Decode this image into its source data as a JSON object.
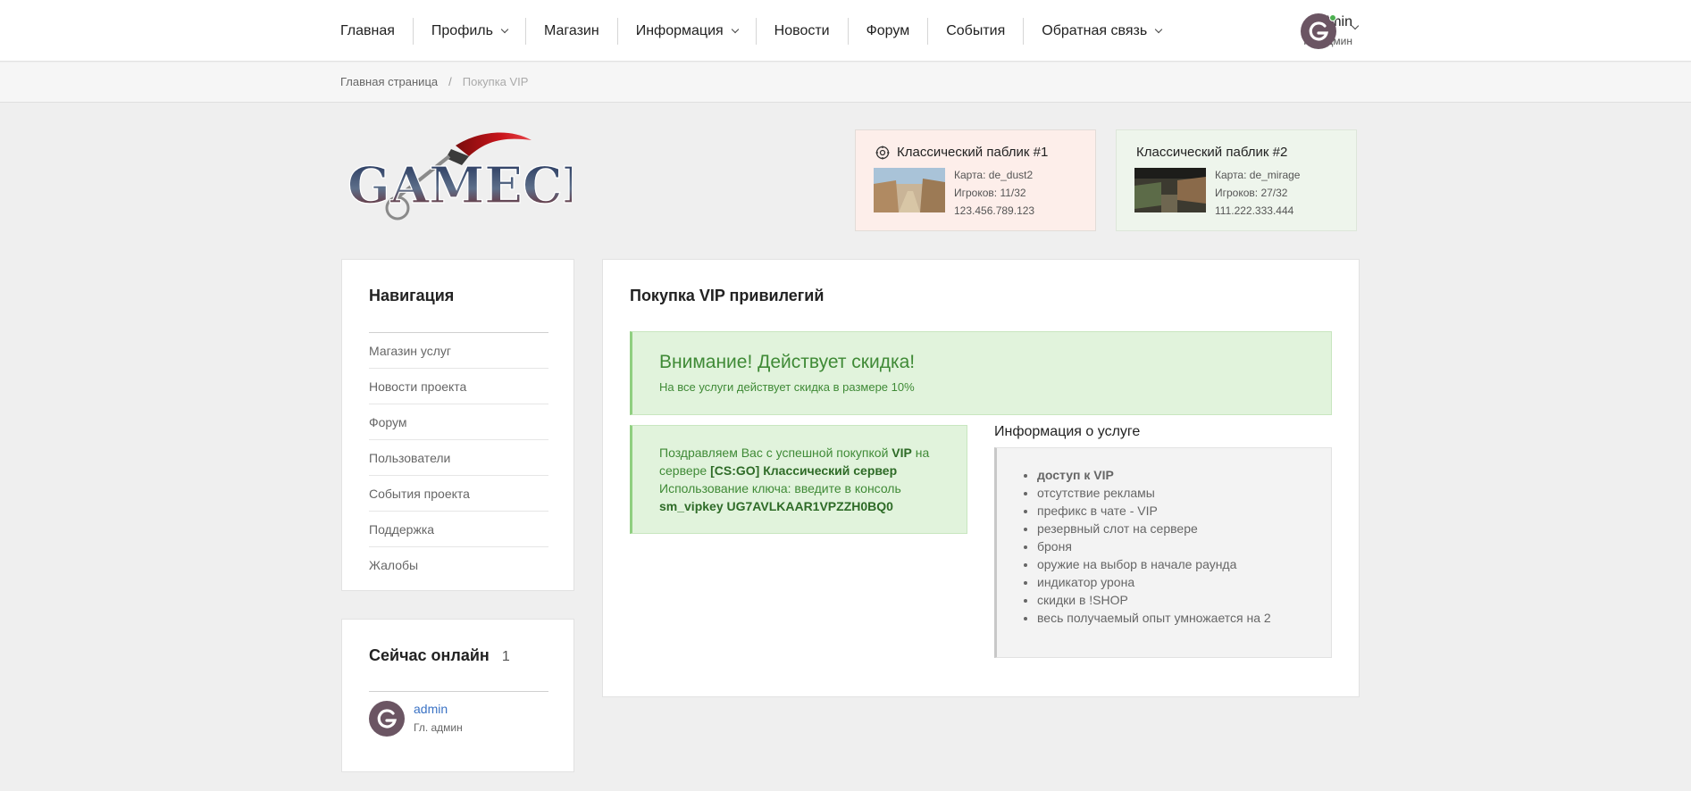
{
  "nav": {
    "items": [
      {
        "label": "Главная",
        "dropdown": false
      },
      {
        "label": "Профиль",
        "dropdown": true
      },
      {
        "label": "Магазин",
        "dropdown": false
      },
      {
        "label": "Информация",
        "dropdown": true
      },
      {
        "label": "Новости",
        "dropdown": false
      },
      {
        "label": "Форум",
        "dropdown": false
      },
      {
        "label": "События",
        "dropdown": false
      },
      {
        "label": "Обратная связь",
        "dropdown": true
      }
    ],
    "user": {
      "name": "admin",
      "role": "Гл. админ",
      "status_color": "#4caf50"
    }
  },
  "breadcrumb": {
    "home": "Главная страница",
    "separator": "/",
    "current": "Покупка VIP"
  },
  "logo": {
    "text": "GAMECMS"
  },
  "servers": [
    {
      "title": "Классический паблик #1",
      "map": "Карта: de_dust2",
      "players": "Игроков: 11/32",
      "address": "123.456.789.123",
      "bg": "#fdeeea"
    },
    {
      "title": "Классический паблик #2",
      "map": "Карта: de_mirage",
      "players": "Игроков: 27/32",
      "address": "111.222.333.444",
      "bg": "#eef5ec"
    }
  ],
  "sidebar": {
    "title": "Навигация",
    "items": [
      "Магазин услуг",
      "Новости проекта",
      "Форум",
      "Пользователи",
      "События проекта",
      "Поддержка",
      "Жалобы"
    ]
  },
  "online": {
    "title": "Сейчас онлайн",
    "count": "1",
    "users": [
      {
        "name": "admin",
        "role": "Гл. админ"
      }
    ]
  },
  "main": {
    "title": "Покупка VIP привилегий",
    "discount": {
      "title": "Внимание! Действует скидка!",
      "text": "На все услуги действует скидка в размере 10%"
    },
    "success": {
      "t1": "Поздравляем Вас с успешной покупкой ",
      "vip": "VIP",
      "t2": " на сервере ",
      "server": "[CS:GO] Классический сервер",
      "t3": "Использование ключа: введите в консоль",
      "key": "sm_vipkey UG7AVLKAAR1VPZZH0BQ0"
    },
    "info": {
      "title": "Информация о услуге",
      "items": [
        "доступ к VIP",
        "отсутствие рекламы",
        "префикс в чате - VIP",
        "резервный слот на сервере",
        "броня",
        "оружие на выбор в начале раунда",
        "индикатор урона",
        "скидки в !SHOP",
        "весь получаемый опыт умножается на 2"
      ]
    }
  },
  "colors": {
    "accent_green": "#3f8a36",
    "link_blue": "#3a72c4",
    "avatar": "#6b5563"
  }
}
